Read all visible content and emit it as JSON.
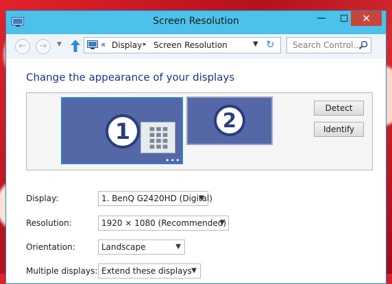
{
  "window": {
    "title": "Screen Resolution",
    "controls": {
      "minimize": "—",
      "maximize": "□",
      "close": "✕"
    }
  },
  "navbar": {
    "back_icon": "arrow-left-icon",
    "forward_icon": "arrow-right-icon",
    "up_icon": "arrow-up-icon",
    "address_prefix": "«",
    "breadcrumb": [
      "Display",
      "Screen Resolution"
    ],
    "breadcrumb_separator": "▸",
    "search_placeholder": "Search Control..."
  },
  "content": {
    "heading": "Change the appearance of your displays",
    "monitors": [
      {
        "number": "1",
        "selected": true
      },
      {
        "number": "2",
        "selected": false
      }
    ],
    "buttons": {
      "detect": "Detect",
      "identify": "Identify"
    },
    "fields": [
      {
        "label": "Display:",
        "value": "1. BenQ G2420HD (Digital)"
      },
      {
        "label": "Resolution:",
        "value": "1920 × 1080 (Recommended)"
      },
      {
        "label": "Orientation:",
        "value": "Landscape"
      },
      {
        "label": "Multiple displays:",
        "value": "Extend these displays"
      }
    ]
  },
  "colors": {
    "titlebar": "#4cc2ea",
    "close_button": "#c7463a",
    "heading": "#1e3287",
    "monitor": "#5468a8",
    "monitor_selected_border": "#2e7fd3"
  }
}
